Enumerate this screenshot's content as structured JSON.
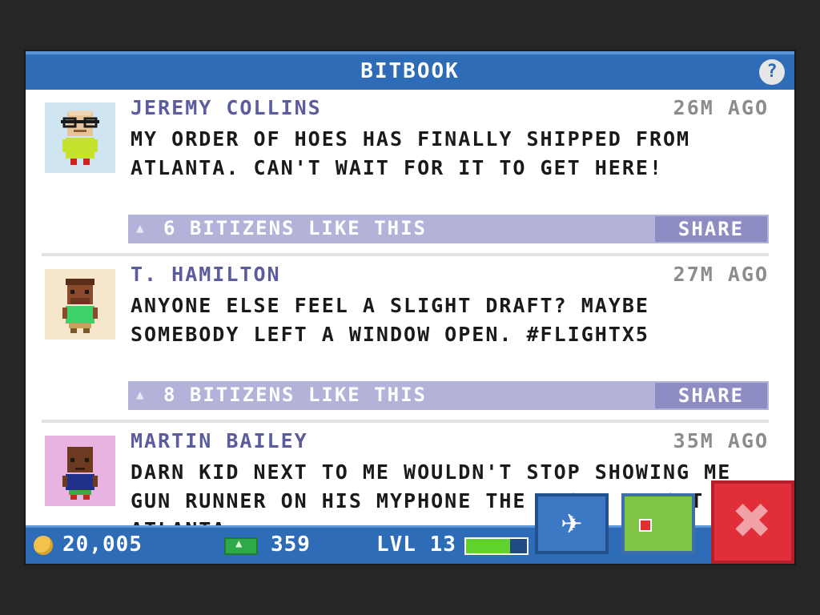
{
  "window": {
    "title": "BITBOOK",
    "help_label": "?"
  },
  "posts": [
    {
      "author": "JEREMY COLLINS",
      "time": "26M AGO",
      "message": "MY ORDER OF HOES HAS FINALLY SHIPPED FROM ATLANTA. CAN'T WAIT FOR IT TO GET HERE!",
      "likes": "6 BITIZENS LIKE THIS",
      "share_label": "SHARE",
      "avatar_bg": "#cfe6f2"
    },
    {
      "author": "T. HAMILTON",
      "time": "27M AGO",
      "message": "ANYONE ELSE FEEL A SLIGHT DRAFT? MAYBE SOMEBODY LEFT A WINDOW OPEN. #FLIGHTX5",
      "likes": "8 BITIZENS LIKE THIS",
      "share_label": "SHARE",
      "avatar_bg": "#f5e6cc"
    },
    {
      "author": "MARTIN BAILEY",
      "time": "35M AGO",
      "message": "DARN KID NEXT TO ME WOULDN'T STOP SHOWING ME GUN RUNNER ON HIS MYPHONE THE WHOLE FLIGHT TO ATLANTA.",
      "avatar_bg": "#e8b3e0"
    }
  ],
  "status": {
    "coins": "20,005",
    "bux": "359",
    "level": "LVL 13",
    "xp_fraction": 0.72
  },
  "colors": {
    "accent": "#2f6cb7",
    "like_bar": "#b3b3d9",
    "close": "#e12f3a",
    "xp": "#5fd22d"
  },
  "icons": {
    "help": "help-icon",
    "plane": "airplane-icon",
    "map": "map-icon",
    "close": "close-icon",
    "coin": "coin-icon",
    "bux": "bux-icon"
  }
}
